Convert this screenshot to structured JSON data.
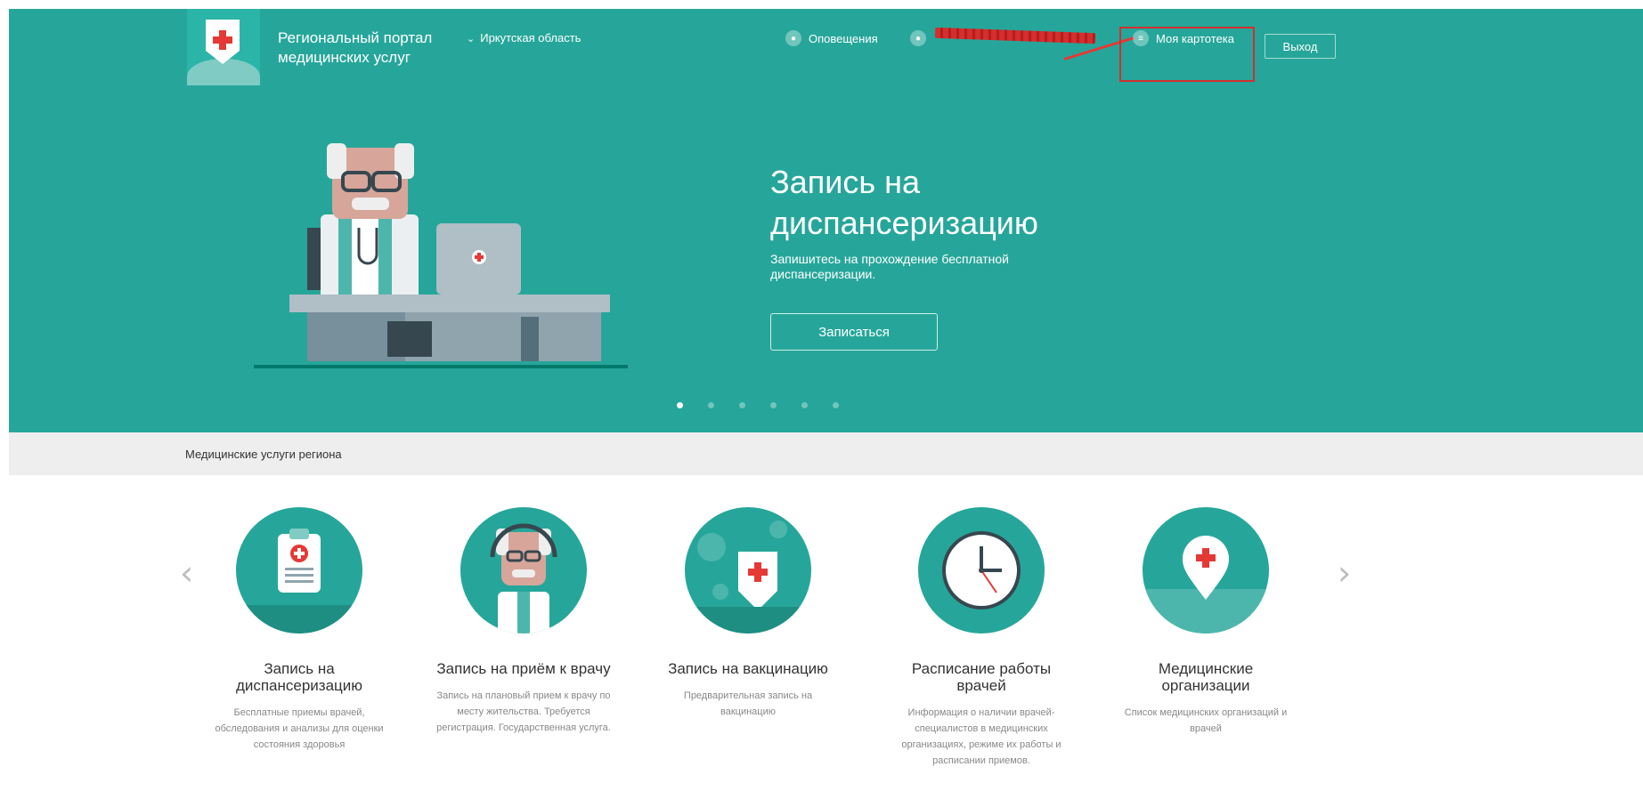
{
  "header": {
    "portal_title": "Региональный портал медицинских услуг",
    "region": "Иркутская область",
    "notifications": "Оповещения",
    "my_file": "Моя картотека",
    "logout": "Выход"
  },
  "hero": {
    "title": "Запись на диспансеризацию",
    "subtitle": "Запишитесь на прохождение бесплатной диспансеризации.",
    "button": "Записаться",
    "slides": 6,
    "active_slide": 1
  },
  "section": {
    "title": "Медицинские услуги региона"
  },
  "services": [
    {
      "name": "Запись на диспансеризацию",
      "desc": "Бесплатные приемы врачей, обследования и анализы для оценки состояния здоровья"
    },
    {
      "name": "Запись на приём к врачу",
      "desc": "Запись на плановый прием к врачу по месту жительства. Требуется регистрация. Государственная услуга."
    },
    {
      "name": "Запись на вакцинацию",
      "desc": "Предварительная запись на вакцинацию"
    },
    {
      "name": "Расписание работы врачей",
      "desc": "Информация о наличии врачей-специалистов в медицинских организациях, режиме их работы и расписании приемов."
    },
    {
      "name": "Медицинские организации",
      "desc": "Список медицинских организаций и врачей"
    }
  ],
  "colors": {
    "primary": "#26a69a",
    "accent": "#e53935"
  }
}
